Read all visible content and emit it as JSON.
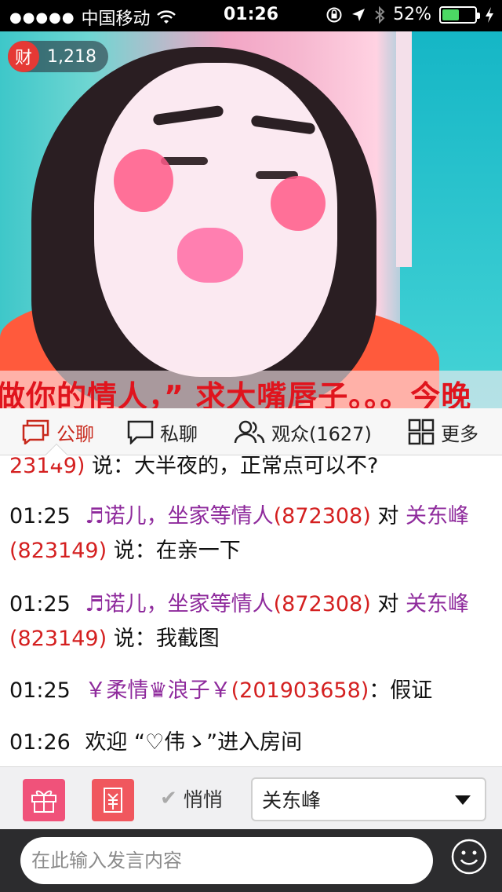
{
  "status_bar": {
    "signal": "●●●●●",
    "carrier": "中国移动",
    "time": "01:26",
    "battery": "52%",
    "battery_level": 0.52
  },
  "video": {
    "wealth_badge_label": "财",
    "wealth_count": "1,218",
    "subtitle": "做你的情人，” 求大嘴唇子。。。今晚"
  },
  "tabs": {
    "public_chat": "公聊",
    "private_chat": "私聊",
    "audience": "观众(1627)",
    "more": "更多"
  },
  "chat": {
    "partial_line": {
      "id_tail": "23149)",
      "text": " 说：大半夜的，正常点可以不?"
    },
    "messages": [
      {
        "time": "01:25",
        "sender": "♬诺儿，坐家等情人",
        "sender_id": "(872308)",
        "connector": "对",
        "target": "关东峰",
        "target_id": "(823149)",
        "text": " 说：在亲一下"
      },
      {
        "time": "01:25",
        "sender": "♬诺儿，坐家等情人",
        "sender_id": "(872308)",
        "connector": "对",
        "target": "关东峰",
        "target_id": "(823149)",
        "text": " 说：我截图"
      },
      {
        "time": "01:25",
        "sender": "￥柔情♛浪子￥",
        "sender_id": "(201903658)",
        "text": "：假证"
      }
    ],
    "welcome": {
      "time": "01:26",
      "text": "欢迎 “♡伟ゝ”进入房间"
    }
  },
  "actions": {
    "whisper_label": "悄悄",
    "target_selected": "关东峰"
  },
  "input": {
    "placeholder": "在此输入发言内容"
  },
  "colors": {
    "accent_red": "#c8291c",
    "name_purple": "#8e2a9c",
    "gift_pink": "#f0527a"
  }
}
